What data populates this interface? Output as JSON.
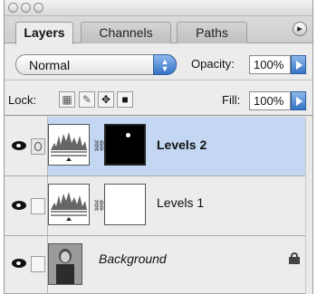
{
  "tabs": [
    {
      "label": "Layers",
      "active": true
    },
    {
      "label": "Channels",
      "active": false
    },
    {
      "label": "Paths",
      "active": false
    }
  ],
  "blend_mode": {
    "selected": "Normal"
  },
  "opacity": {
    "label": "Opacity:",
    "value": "100%"
  },
  "lock": {
    "label": "Lock:"
  },
  "fill": {
    "label": "Fill:",
    "value": "100%"
  },
  "layers": [
    {
      "name": "Levels 2",
      "type": "adjustment",
      "selected": true,
      "italic": false
    },
    {
      "name": "Levels 1",
      "type": "adjustment",
      "selected": false,
      "italic": false
    },
    {
      "name": "Background",
      "type": "image",
      "selected": false,
      "italic": true
    }
  ],
  "colors": {
    "selected_row": "#c3d7f3",
    "accent_blue": "#3673c6"
  },
  "icons": [
    "eye-icon",
    "layer-mask-link-icon",
    "chain-link-icon",
    "lock-icon",
    "move-icon",
    "brush-icon",
    "transparency-icon",
    "panel-menu-icon"
  ]
}
